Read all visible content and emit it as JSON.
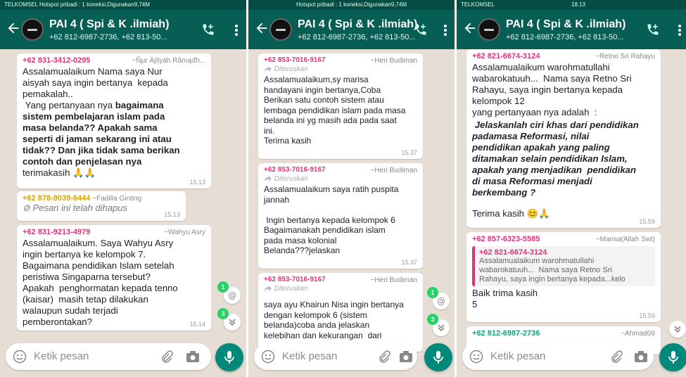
{
  "colors": {
    "header": "#075e54",
    "accent": "#00897b",
    "chat_bg": "#e6ddd4"
  },
  "panels": [
    {
      "statusbar": "TELKOMSEL  Hotspot pribadi : 1 koneksi,Digunakan9,74M",
      "chat": {
        "title": "PAI 4 ( Spi & K .ilmiah)",
        "subtitle": "+62 812-6987-2736, +62 813-50..."
      },
      "messages": [
        {
          "sender": "+62 831-3412-0295",
          "sender_name": "~Ñµr Äjšyàh Râmąďh...",
          "lines": [
            "Assalamualaikum Nama saya Nur",
            "aisyah saya ingin bertanya  kepada",
            "pemakalah..",
            " Yang pertanyaan nya "
          ],
          "bold_lines": [
            "bagaimana",
            "sistem pembelajaran islam pada",
            "masa belanda?? Apakah sama",
            "seperti di jaman sekarang ini atau",
            "tidak?? Dan jika tidak sama berikan",
            "contoh dan penjelasan nya"
          ],
          "tail": "terimakasih 🙏🙏",
          "time": "15.13"
        },
        {
          "sender": "+62 878-9039-6444",
          "sender_name": "~Fadilla Ginting",
          "deleted": "Pesan ini telah dihapus",
          "time": "15.13"
        },
        {
          "sender": "+62 831-9213-4979",
          "sender_name": "~Wahyu Asry",
          "text": "Assalamualaikum. Saya Wahyu Asry\ningin bertanya ke kelompok 7.\nBagaimana pendidikan Islam setelah\nperistiwa Singaparna tersebut?\nApakah  penghormatan kepada tenno\n(kaisar)  masih tetap dilakukan\nwalaupun sudah terjadi\npemberontakan?",
          "time": "15.14"
        }
      ],
      "badges": [
        "1",
        "3"
      ],
      "composer_placeholder": "Ketik pesan"
    },
    {
      "statusbar": "Hotspot pribadi : 1 koneksi,Digunakan9,74M",
      "chat": {
        "title": "PAI 4 ( Spi & K .ilmiah)",
        "subtitle": "+62 812-6987-2736, +62 813-50..."
      },
      "messages": [
        {
          "sender": "+62 853-7016-9167",
          "sender_name": "~Heri Budiman",
          "forwarded": "Diteruskan",
          "text": "Assalamualaikum,sy marisa\nhandayani ingin bertanya,Coba\nBerikan satu contoh sistem atau\nlembaga pendidikan islam pada masa\nbelanda ini yg masih ada pada saat\nini.\nTerima kasih",
          "time": "15.37"
        },
        {
          "sender": "+62 853-7016-9167",
          "sender_name": "~Heri Budiman",
          "forwarded": "Diteruskan",
          "text": "Assalamualaikum saya ratih puspita\njannah\n\n Ingin bertanya kepada kelompok 6\nBagaimanakah pendidikan islam\npada masa kolonial\nBelanda???jelaskan",
          "time": "15.37"
        },
        {
          "sender": "+62 853-7016-9167",
          "sender_name": "~Heri Budiman",
          "forwarded": "Diteruskan",
          "text": "saya ayu Khairun Nisa ingin bertanya\ndengan kelompok 6 (sistem\nbelanda)coba anda jelaskan\nkelebihan dan kekurangan  dari",
          "time": ""
        }
      ],
      "badges": [
        "1",
        "3"
      ],
      "composer_placeholder": "Ketik pesan"
    },
    {
      "statusbar": "TELKOMSEL",
      "statusbar_time": "18.13",
      "chat": {
        "title": "PAI 4 ( Spi & K .ilmiah)",
        "subtitle": "+62 812-6987-2736, +62 813-50..."
      },
      "messages": [
        {
          "sender": "+62 821-6674-3124",
          "sender_name": "~Retno Sri Rahayu",
          "text": "Assalamualaikum warohmatullahi\nwabarokatuuh...  Nama saya Retno Sri\nRahayu, saya ingin bertanya kepada\nkelompok 12\nyang pertanyaan nya adalah  :",
          "bold_italic": " Jelaskanlah ciri khas dari pendidikan\npadamasa Reformasi, nilai\npendidikan apakah yang paling\nditamakan selain pendidikan Islam,\napakah yang menjadikan  pendidikan\ndi masa Reformasi menjadi\nberkembang ?",
          "tail": "Terima kasih 😊🙏",
          "time": "15.59"
        },
        {
          "sender": "+62 857-6323-5585",
          "sender_name": "~Marisa(Allah Swt)",
          "quote_sender": "+62 821-6674-3124",
          "quote_text": "Assalamualaikum warohmatullahi\nwabarokatuuh...  Nama saya Retno Sri\nRahayu, saya ingin bertanya kepada...kelo",
          "text": "Baik trima kasih\n5",
          "time": "15.59"
        },
        {
          "sender": "+62 812-6987-2736",
          "sender_name": "~Ahmad09",
          "text": "",
          "time": ""
        }
      ],
      "composer_placeholder": "Ketik pesan"
    }
  ]
}
